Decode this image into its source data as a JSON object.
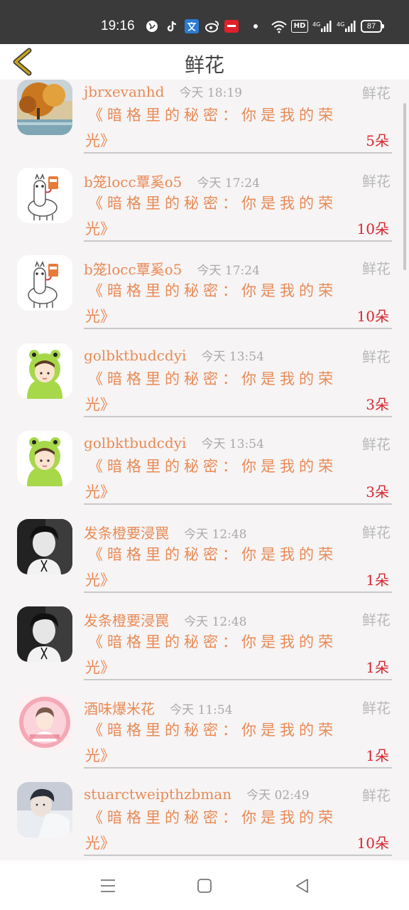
{
  "status": {
    "time": "19:16",
    "hd_label": "HD",
    "signal1_label": "4G",
    "signal2_label": "4G",
    "battery": "87"
  },
  "header": {
    "title": "鲜花"
  },
  "gifts": [
    {
      "user": "jbrxevanhd",
      "time": "今天 18:19",
      "type": "鲜花",
      "book_line1": "《暗格里的秘密：你是我的荣",
      "book_line2": "光》",
      "count": "5朵",
      "avatar": "autumn-tree-avatar"
    },
    {
      "user": "b笼locc覃奚o5",
      "time": "今天 17:24",
      "type": "鲜花",
      "book_line1": "《暗格里的秘密：你是我的荣",
      "book_line2": "光》",
      "count": "10朵",
      "avatar": "alpaca-avatar"
    },
    {
      "user": "b笼locc覃奚o5",
      "time": "今天 17:24",
      "type": "鲜花",
      "book_line1": "《暗格里的秘密：你是我的荣",
      "book_line2": "光》",
      "count": "10朵",
      "avatar": "alpaca-avatar"
    },
    {
      "user": "golbktbudcdyi",
      "time": "今天 13:54",
      "type": "鲜花",
      "book_line1": "《暗格里的秘密：你是我的荣",
      "book_line2": "光》",
      "count": "3朵",
      "avatar": "frog-hood-avatar"
    },
    {
      "user": "golbktbudcdyi",
      "time": "今天 13:54",
      "type": "鲜花",
      "book_line1": "《暗格里的秘密：你是我的荣",
      "book_line2": "光》",
      "count": "3朵",
      "avatar": "frog-hood-avatar"
    },
    {
      "user": "发条橙要浸罠",
      "time": "今天 12:48",
      "type": "鲜花",
      "book_line1": "《暗格里的秘密：你是我的荣",
      "book_line2": "光》",
      "count": "1朵",
      "avatar": "bw-portrait-avatar"
    },
    {
      "user": "发条橙要浸罠",
      "time": "今天 12:48",
      "type": "鲜花",
      "book_line1": "《暗格里的秘密：你是我的荣",
      "book_line2": "光》",
      "count": "1朵",
      "avatar": "bw-portrait-avatar"
    },
    {
      "user": "酒味爆米花",
      "time": "今天 11:54",
      "type": "鲜花",
      "book_line1": "《暗格里的秘密：你是我的荣",
      "book_line2": "光》",
      "count": "1朵",
      "avatar": "pink-portrait-avatar"
    },
    {
      "user": "stuarctweipthzbman",
      "time": "今天 02:49",
      "type": "鲜花",
      "book_line1": "《暗格里的秘密：你是我的荣",
      "book_line2": "光》",
      "count": "10朵",
      "avatar": "blue-portrait-avatar"
    }
  ],
  "colors": {
    "accent": "#e98a55",
    "count": "#d7262e",
    "back_arrow": "#c9a21f",
    "muted": "#a9a9a9"
  },
  "icons": {
    "back": "chevron-left-icon",
    "nav_menu": "menu-icon",
    "nav_home": "home-square-icon",
    "nav_back": "back-triangle-icon"
  }
}
